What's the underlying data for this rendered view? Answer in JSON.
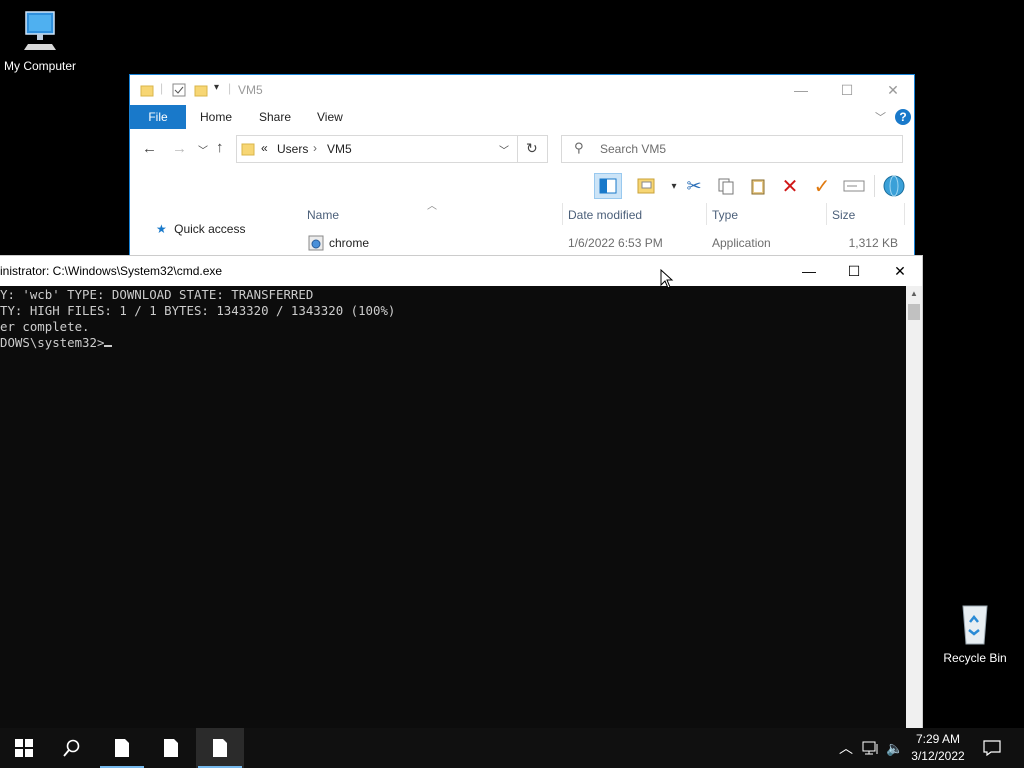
{
  "desktop": {
    "icons": [
      {
        "label": "My Computer"
      },
      {
        "label": "Recycle Bin"
      }
    ]
  },
  "explorer": {
    "title": "VM5",
    "ribbon_tabs": [
      "File",
      "Home",
      "Share",
      "View"
    ],
    "address": {
      "prefix": "«",
      "crumbs": [
        "Users",
        "VM5"
      ]
    },
    "search_placeholder": "Search VM5",
    "nav_pane": {
      "quick_access": "Quick access"
    },
    "columns": [
      "Name",
      "Date modified",
      "Type",
      "Size"
    ],
    "files": [
      {
        "name": "chrome",
        "date": "1/6/2022 6:53 PM",
        "type": "Application",
        "size": "1,312 KB"
      }
    ],
    "accent": "#1979ca"
  },
  "cmd": {
    "title": "inistrator: C:\\Windows\\System32\\cmd.exe",
    "lines": [
      "Y: 'wcb' TYPE: DOWNLOAD STATE: TRANSFERRED",
      "TY: HIGH FILES: 1 / 1 BYTES: 1343320 / 1343320 (100%)",
      "er complete.",
      "",
      "DOWS\\system32>"
    ]
  },
  "taskbar": {
    "clock_time": "7:29 AM",
    "clock_date": "3/12/2022"
  }
}
